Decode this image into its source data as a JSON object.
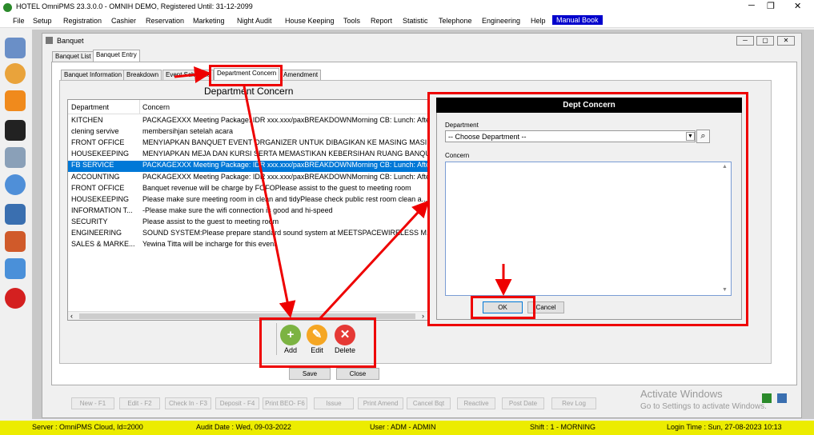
{
  "window": {
    "title": "HOTEL OmniPMS 23.3.0.0 - OMNIH DEMO, Registered Until: 31-12-2099",
    "icon": "omnipms-logo-icon"
  },
  "menu": [
    "File",
    "Setup",
    "Registration",
    "Cashier",
    "Reservation",
    "Marketing",
    "Night Audit",
    "House Keeping",
    "Tools",
    "Report",
    "Statistic",
    "Telephone",
    "Engineering",
    "Help",
    "Manual Book"
  ],
  "sidebar_icons": [
    "notes-icon",
    "users-icon",
    "sitemap-icon",
    "calendar-icon",
    "database-icon",
    "rooms-icon",
    "printer-icon",
    "chart-icon",
    "pie-chart-icon",
    "power-icon"
  ],
  "child": {
    "title": "Banquet"
  },
  "tabs_top": [
    "Banquet List",
    "Banquet Entry"
  ],
  "tabs_inner": [
    "Banquet Information",
    "Breakdown",
    "Event Schedule",
    "Department Concern",
    "Amendment"
  ],
  "section_title": "Department Concern",
  "list": {
    "headers": [
      "Department",
      "Concern"
    ],
    "rows": [
      [
        "KITCHEN",
        "PACKAGEXXX Meeting Package: IDR xxx.xxx/paxBREAKDOWNMorning CB: Lunch: Afte"
      ],
      [
        "clening servive",
        "membersihjan setelah acara"
      ],
      [
        "FRONT OFFICE",
        "MENYIAPKAN BANQUET EVENT ORGANIZER UNTUK DIBAGIKAN KE MASING MASIN..."
      ],
      [
        "HOUSEKEEPING",
        "MENYIAPKAN MEJA DAN KURSI SERTA MEMASTIKAN KEBERSIHAN RUANG BANQU..."
      ],
      [
        "FB SERVICE",
        "PACKAGEXXX Meeting Package: IDR xxx.xxx/paxBREAKDOWNMorning CB: Lunch: Afte"
      ],
      [
        "ACCOUNTING",
        "PACKAGEXXX Meeting Package: IDR xxx.xxx/paxBREAKDOWNMorning CB: Lunch: Afte"
      ],
      [
        "FRONT OFFICE",
        "Banquet revenue will be charge by FOFOPlease assist to the guest to meeting room"
      ],
      [
        "HOUSEKEEPING",
        "Please make sure meeting room in clean and tidyPlease check public rest room clean a..."
      ],
      [
        "INFORMATION T...",
        "-Please make sure the wifi connection is good and hi-speed"
      ],
      [
        "SECURITY",
        "Please assist to the guest to meeting room"
      ],
      [
        "ENGINEERING",
        "SOUND SYSTEM:Please prepare standard sound system at MEETSPACEWIRELESS M..."
      ],
      [
        "SALES & MARKE...",
        "Yewina Titta will be incharge for this event"
      ]
    ],
    "selected": 4
  },
  "toolbar": {
    "add": "Add",
    "edit": "Edit",
    "delete": "Delete"
  },
  "buttons": {
    "save": "Save",
    "close": "Close"
  },
  "bottom_buttons": [
    "New - F1",
    "Edit - F2",
    "Check In - F3",
    "Deposit - F4",
    "Print BEO- F6",
    "Issue",
    "Print Amend",
    "Cancel Bqt",
    "Reactive",
    "Post Date",
    "Rev Log"
  ],
  "dialog": {
    "title": "Dept Concern",
    "department_label": "Department",
    "department_value": "-- Choose Department --",
    "concern_label": "Concern",
    "ok": "OK",
    "cancel": "Cancel"
  },
  "watermark": {
    "line1": "Activate Windows",
    "line2": "Go to Settings to activate Windows."
  },
  "status": {
    "server": "Server : OmniPMS Cloud, Id=2000",
    "audit": "Audit Date : Wed, 09-03-2022",
    "user": "User : ADM - ADMIN",
    "shift": "Shift : 1 - MORNING",
    "login": "Login Time : Sun, 27-08-2023 10:13"
  },
  "colors": {
    "selection": "#0078d7",
    "annotation": "#e00000",
    "statusbar": "#ecec00",
    "menu_highlight": "#0000cc"
  }
}
